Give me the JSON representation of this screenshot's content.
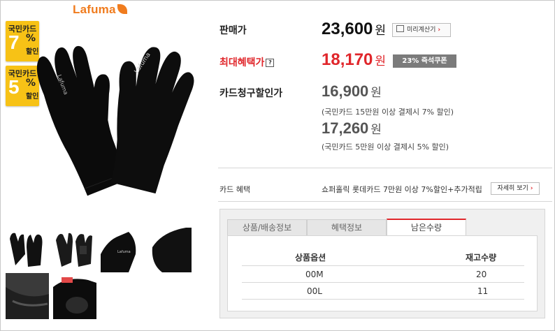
{
  "brand": {
    "name": "Lafuma"
  },
  "badges": [
    {
      "title": "국민카드",
      "num": "7",
      "pct": "%",
      "sub": "할인"
    },
    {
      "title": "국민카드",
      "num": "5",
      "pct": "%",
      "sub": "할인"
    }
  ],
  "sale": {
    "label": "판매가",
    "price": "23,600",
    "unit": "원",
    "calc_button": "미리계산기"
  },
  "max": {
    "label": "최대혜택가",
    "help": "?",
    "price": "18,170",
    "unit": "원",
    "coupon": "23% 즉석쿠폰"
  },
  "card_price": {
    "label": "카드청구할인가",
    "price1": "16,900",
    "unit1": "원",
    "note1": "(국민카드 15만원 이상 결제시 7% 할인)",
    "price2": "17,260",
    "unit2": "원",
    "note2": "(국민카드 5만원 이상 결제시 5% 할인)"
  },
  "card_benefit": {
    "label": "카드 혜택",
    "text": "쇼퍼홀릭 롯데카드 7만원 이상 7%할인+추가적립",
    "button": "자세히 보기"
  },
  "tabs": [
    "상품/배송정보",
    "혜택정보",
    "남은수량"
  ],
  "stock": {
    "headers": [
      "상품옵션",
      "재고수량"
    ],
    "rows": [
      {
        "option": "00M",
        "qty": "20"
      },
      {
        "option": "00L",
        "qty": "11"
      }
    ]
  },
  "colors": {
    "accent": "#e0262b",
    "badge": "#f7c216",
    "brand": "#f07c1e",
    "coupon": "#7b7b7b"
  }
}
